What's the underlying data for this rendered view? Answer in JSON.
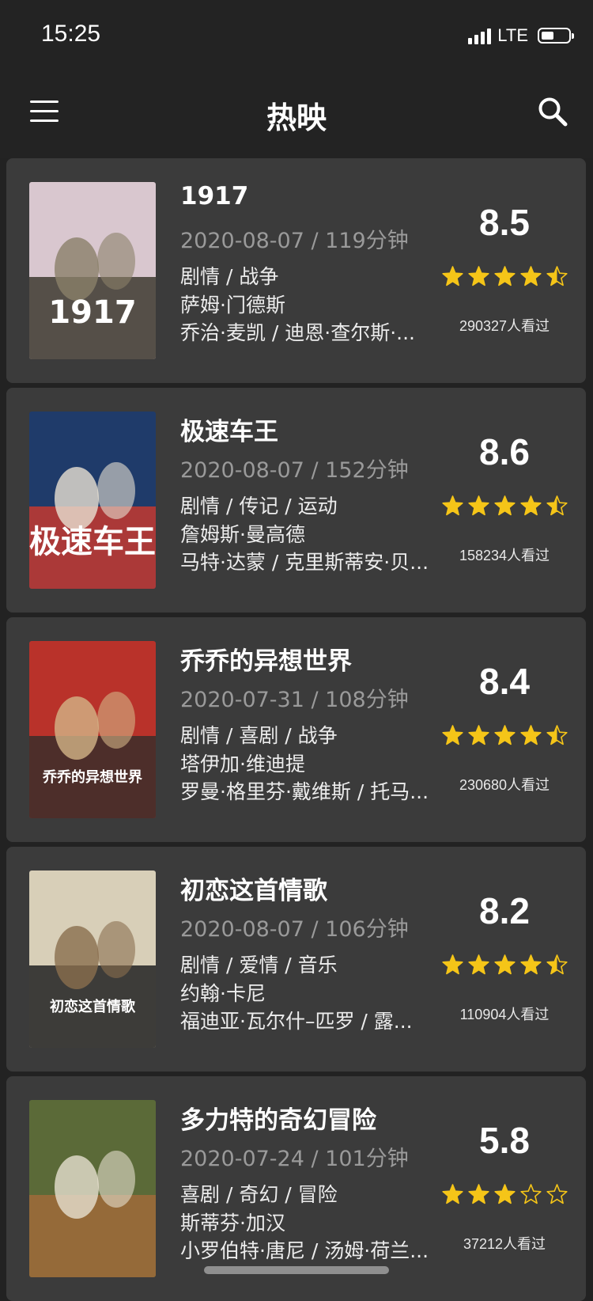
{
  "status": {
    "time": "15:25",
    "network": "LTE",
    "battery_percent": 45
  },
  "nav": {
    "title": "热映",
    "menu_icon": "hamburger-menu-icon",
    "search_icon": "search-icon"
  },
  "colors": {
    "background": "#222222",
    "card": "#3b3b3b",
    "star": "#f5c518",
    "date_text": "#9a9a9a"
  },
  "movies": [
    {
      "title": "1917",
      "date_runtime": "2020-08-07 / 119分钟",
      "genres": "剧情 / 战争",
      "director": "萨姆·门德斯",
      "cast": "乔治·麦凯 / 迪恩·查尔斯·...",
      "score": "8.5",
      "stars": 4.5,
      "viewers": "290327人看过",
      "poster_text": "1917"
    },
    {
      "title": "极速车王",
      "date_runtime": "2020-08-07 / 152分钟",
      "genres": "剧情 / 传记 / 运动",
      "director": "詹姆斯·曼高德",
      "cast": "马特·达蒙 / 克里斯蒂安·贝...",
      "score": "8.6",
      "stars": 4.5,
      "viewers": "158234人看过",
      "poster_text": "极速车王"
    },
    {
      "title": "乔乔的异想世界",
      "date_runtime": "2020-07-31 / 108分钟",
      "genres": "剧情 / 喜剧 / 战争",
      "director": "塔伊加·维迪提",
      "cast": "罗曼·格里芬·戴维斯 / 托马...",
      "score": "8.4",
      "stars": 4.5,
      "viewers": "230680人看过",
      "poster_text": "乔乔的异想世界"
    },
    {
      "title": "初恋这首情歌",
      "date_runtime": "2020-08-07 / 106分钟",
      "genres": "剧情 / 爱情 / 音乐",
      "director": "约翰·卡尼",
      "cast": "福迪亚·瓦尔什–匹罗 / 露...",
      "score": "8.2",
      "stars": 4.5,
      "viewers": "110904人看过",
      "poster_text": "初恋这首情歌"
    },
    {
      "title": "多力特的奇幻冒险",
      "date_runtime": "2020-07-24 / 101分钟",
      "genres": "喜剧 / 奇幻 / 冒险",
      "director": "斯蒂芬·加汉",
      "cast": "小罗伯特·唐尼 / 汤姆·荷兰...",
      "score": "5.8",
      "stars": 3,
      "viewers": "37212人看过",
      "poster_text": ""
    }
  ]
}
